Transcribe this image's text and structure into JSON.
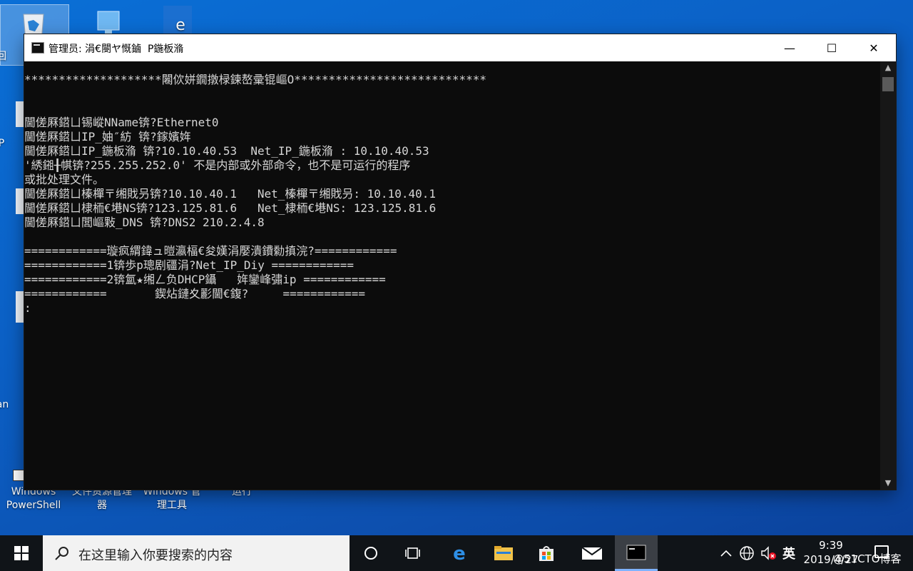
{
  "window": {
    "title": "管理员: 涓€閿ヤ慨鏀  P鍦板潃",
    "controls": {
      "minimize": "—",
      "maximize": "☐",
      "close": "✕"
    }
  },
  "console": {
    "lines": [
      "********************闂佽姘鐗撴椂鍊嶅彚锟嶇O****************************",
      "",
      "",
      "閫傞厤鍣ㄩ锡嵷NName锛?Ethernet0",
      "閫傞厤鍣ㄩIP_妯″紡 锛?鎵嬪姩",
      "閫傞厤鍣ㄩIP_鍦板潃 锛?10.10.40.53  Net_IP_鍦板潃 : 10.10.40.53",
      "'綉鎺╂帺锛?255.255.252.0' 不是内部或外部命令，也不是可运行的程序",
      "或批处理文件。",
      "閫傞厤鍣ㄩ榛樿〒缃戝叧锛?10.10.40.1   Net_榛樿〒缃戝叧: 10.10.40.1",
      "閫傞厤鍣ㄩ棣栭€塂NS锛?123.125.81.6   Net_棣栭€塂NS: 123.125.81.6",
      "閫傞厤鍣ㄩ閭嶇敤_DNS 锛?DNS2 210.2.4.8",
      "",
      "============璇疯緭鍏ュ暟瀛楅€夋嫨涓嬮潰鐨勬搷浣?============",
      "============1锛歩p璁剧疆涓?Net_IP_Diy ============",
      "============2锛氳★缃ㄥ负DHCP鑷   姩鑾峰彇ip ============",
      "============       鍥炶鏈夊彲閫€鍑?     ============",
      ":"
    ]
  },
  "desktop": {
    "icons": [
      {
        "label": "Windows PowerShell"
      },
      {
        "label": "文件资源管理器"
      },
      {
        "label": "Windows 管理工具"
      },
      {
        "label": "运行"
      }
    ],
    "left_stubs": [
      "回",
      "P",
      "Tean"
    ]
  },
  "taskbar": {
    "search_placeholder": "在这里输入你要搜索的内容",
    "ime": "英",
    "time": "9:39",
    "date": "2019/4/27",
    "watermark": "@51CTO博客"
  }
}
